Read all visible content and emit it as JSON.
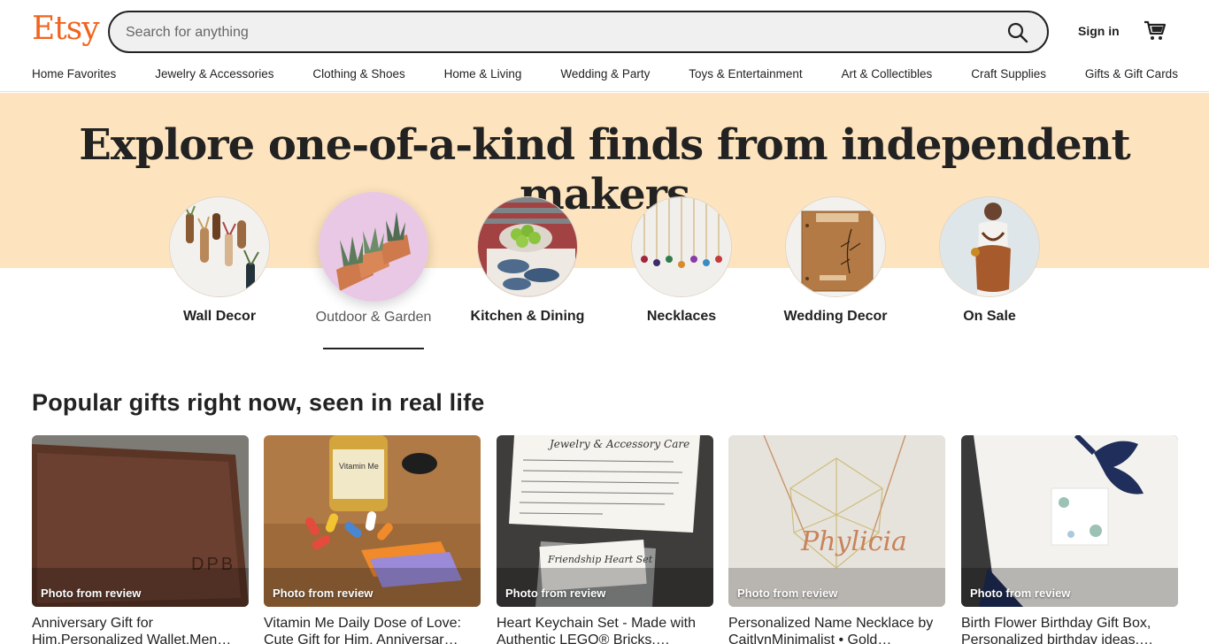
{
  "header": {
    "logo": "Etsy",
    "search_placeholder": "Search for anything",
    "sign_in": "Sign in"
  },
  "nav": [
    "Home Favorites",
    "Jewelry & Accessories",
    "Clothing & Shoes",
    "Home & Living",
    "Wedding & Party",
    "Toys & Entertainment",
    "Art & Collectibles",
    "Craft Supplies",
    "Gifts & Gift Cards"
  ],
  "hero": {
    "title": "Explore one-of-a-kind finds from independent makers",
    "categories": [
      {
        "label": "Wall Decor"
      },
      {
        "label": "Outdoor & Garden"
      },
      {
        "label": "Kitchen & Dining"
      },
      {
        "label": "Necklaces"
      },
      {
        "label": "Wedding Decor"
      },
      {
        "label": "On Sale"
      }
    ]
  },
  "popular": {
    "title": "Popular gifts right now, seen in real life",
    "badge": "Photo from review",
    "items": [
      {
        "title": "Anniversary Gift for Him,Personalized Wallet,Men…"
      },
      {
        "title": "Vitamin Me Daily Dose of Love: Cute Gift for Him, Anniversar…"
      },
      {
        "title": "Heart Keychain Set - Made with Authentic LEGO® Bricks,…"
      },
      {
        "title": "Personalized Name Necklace by CaitlynMinimalist • Gold…"
      },
      {
        "title": "Birth Flower Birthday Gift Box, Personalized birthday ideas,…"
      }
    ]
  },
  "colors": {
    "brand": "#f1641e",
    "hero_band": "#fde4be"
  },
  "icons": [
    "search-icon",
    "cart-icon"
  ]
}
